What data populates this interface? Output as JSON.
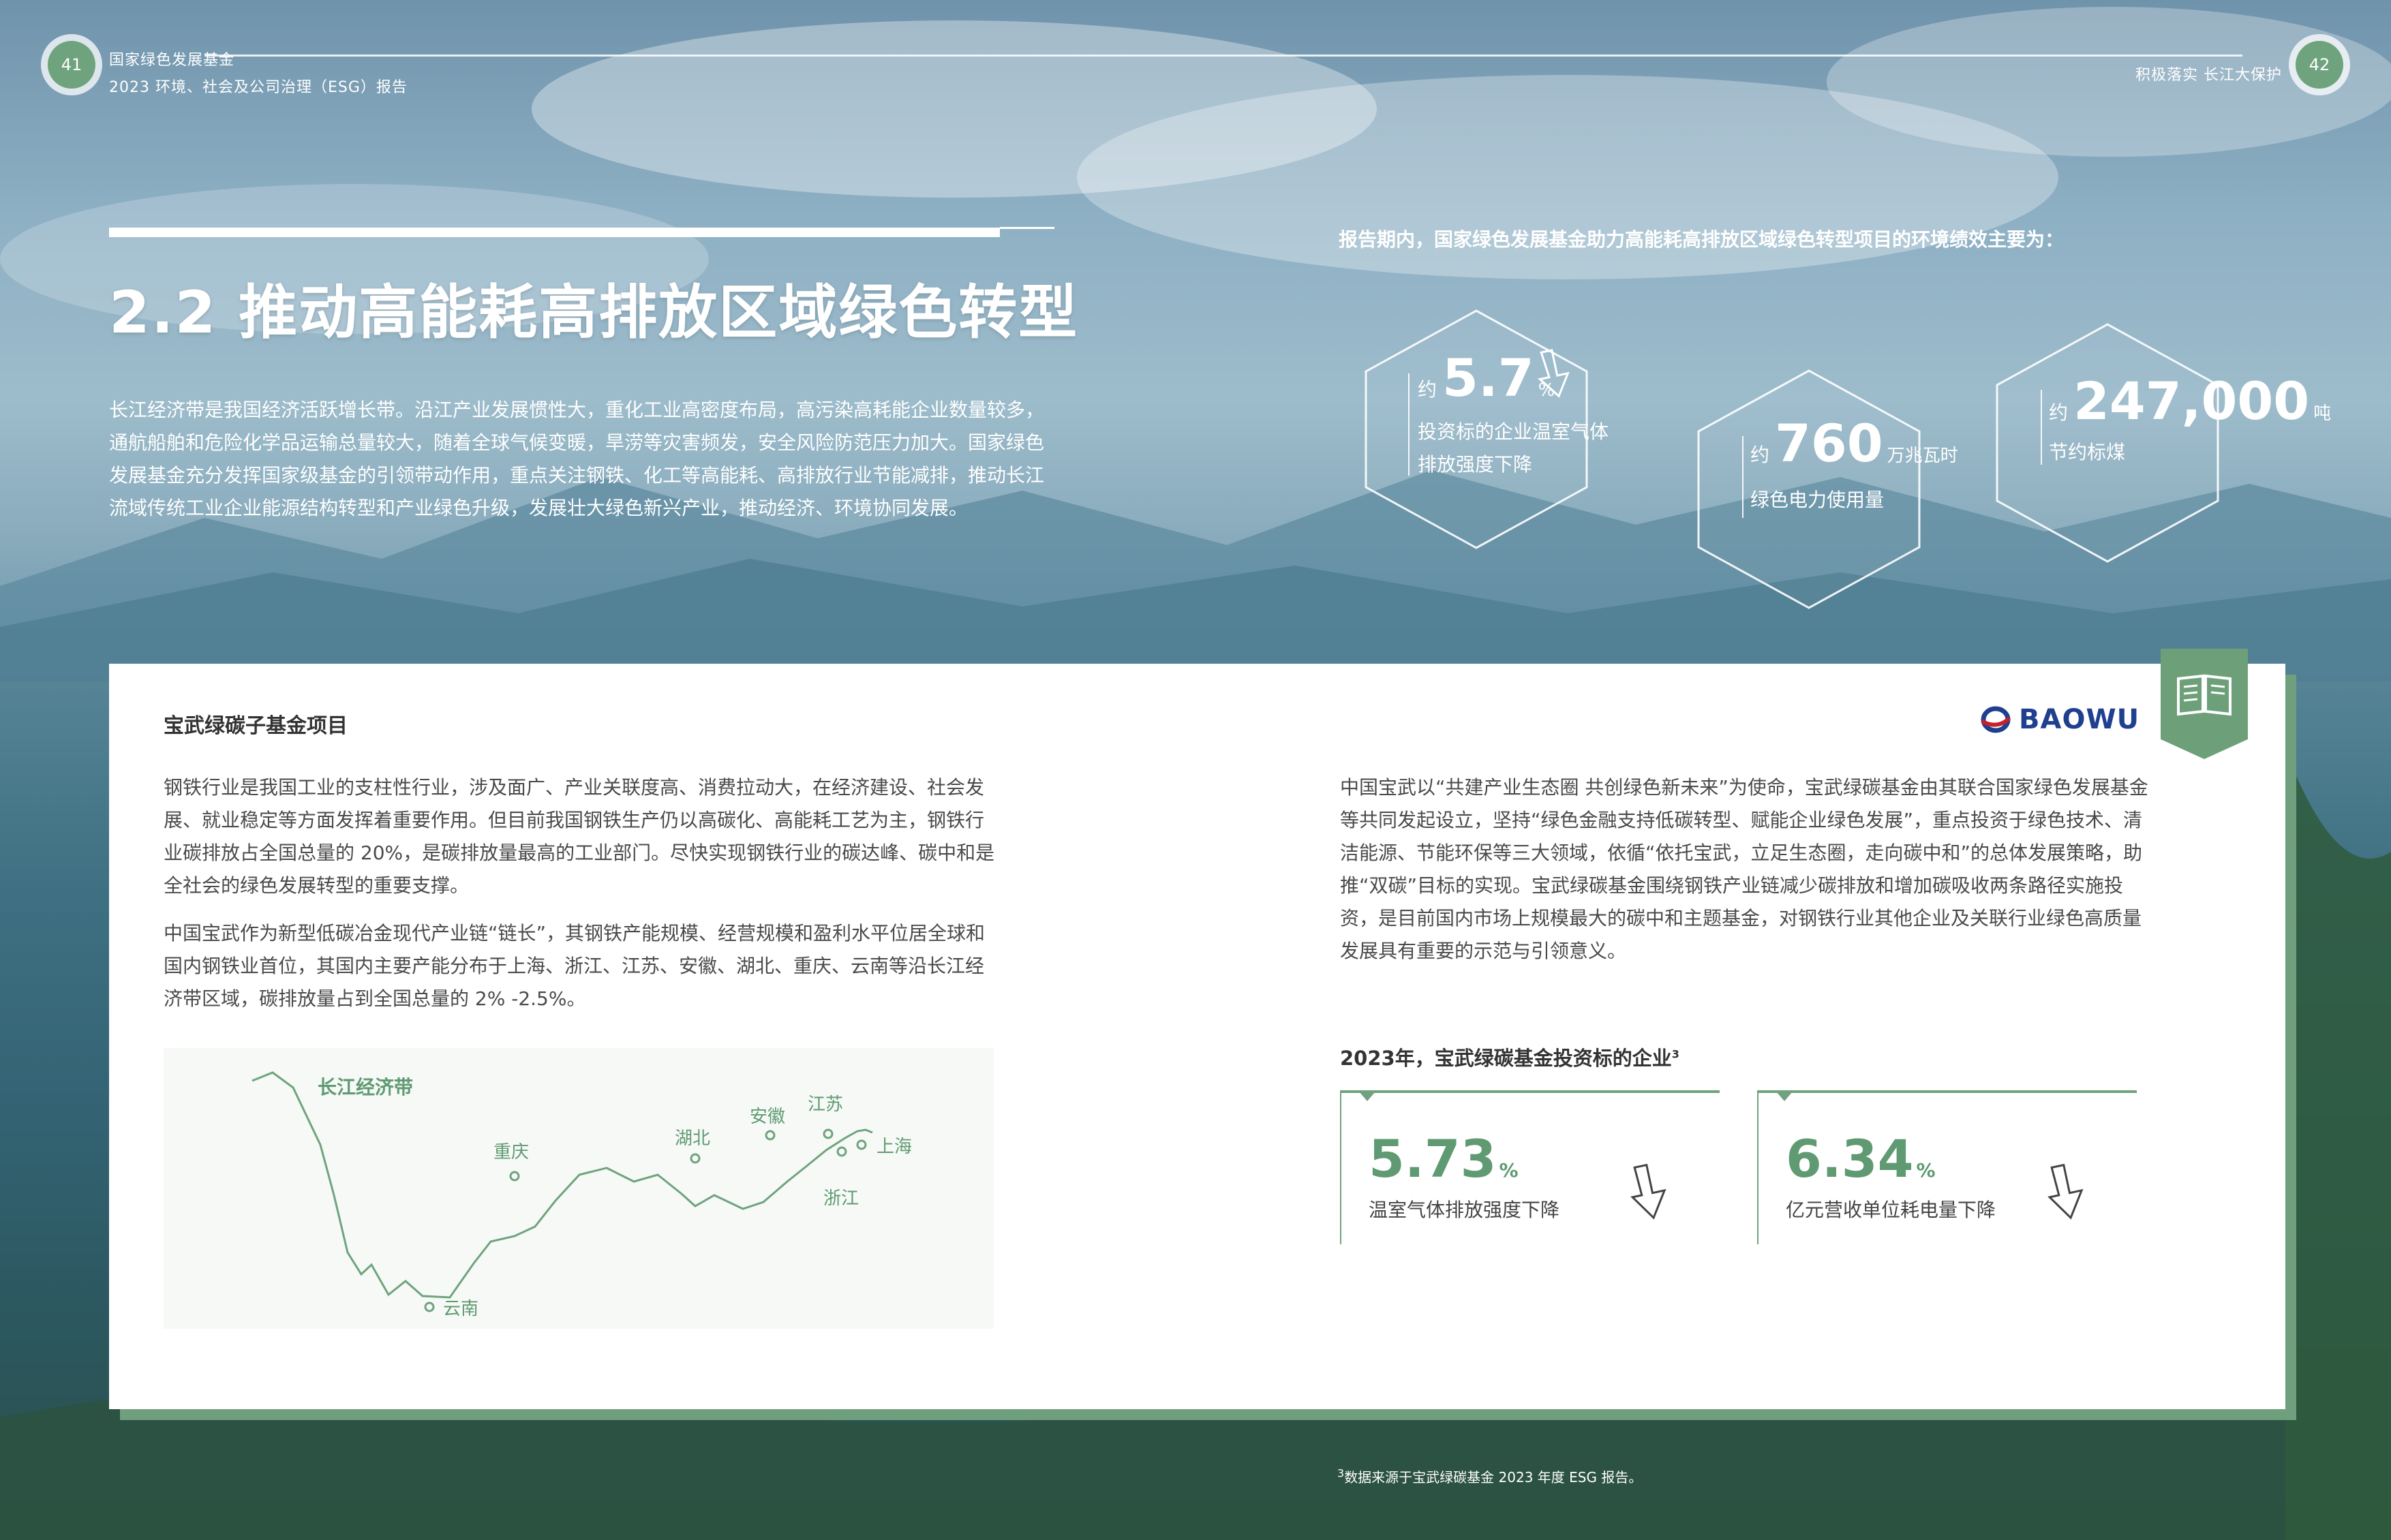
{
  "header": {
    "org": "国家绿色发展基金",
    "report": "2023 环境、社会及公司治理（ESG）报告",
    "right_section": "积极落实 长江大保护",
    "page_left": "41",
    "page_right": "42"
  },
  "section": {
    "title": "2.2 推动高能耗高排放区域绿色转型",
    "intro": "长江经济带是我国经济活跃增长带。沿江产业发展惯性大，重化工业高密度布局，高污染高耗能企业数量较多，通航船舶和危险化学品运输总量较大，随着全球气候变暖，旱涝等灾害频发，安全风险防范压力加大。国家绿色发展基金充分发挥国家级基金的引领带动作用，重点关注钢铁、化工等高能耗、高排放行业节能减排，推动长江流域传统工业企业能源结构转型和产业绿色升级，发展壮大绿色新兴产业，推动经济、环境协同发展。"
  },
  "performance": {
    "title": "报告期内，国家绿色发展基金助力高能耗高排放区域绿色转型项目的环境绩效主要为：",
    "stats": [
      {
        "prefix": "约",
        "value": "5.7",
        "unit": "%",
        "desc_line1": "投资标的企业温室气体",
        "desc_line2": "排放强度下降"
      },
      {
        "prefix": "约",
        "value": "760",
        "unit": "万兆瓦时",
        "desc_line1": "绿色电力使用量"
      },
      {
        "prefix": "约",
        "value": "247,000",
        "unit": "吨",
        "desc_line1": "节约标煤"
      }
    ]
  },
  "case": {
    "heading": "宝武绿碳子基金项目",
    "logo_text": "BAOWU",
    "para1": "钢铁行业是我国工业的支柱性行业，涉及面广、产业关联度高、消费拉动大，在经济建设、社会发展、就业稳定等方面发挥着重要作用。但目前我国钢铁生产仍以高碳化、高能耗工艺为主，钢铁行业碳排放占全国总量的 20%，是碳排放量最高的工业部门。尽快实现钢铁行业的碳达峰、碳中和是全社会的绿色发展转型的重要支撑。",
    "para2": "中国宝武作为新型低碳冶金现代产业链“链长”，其钢铁产能规模、经营规模和盈利水平位居全球和国内钢铁业首位，其国内主要产能分布于上海、浙江、江苏、安徽、湖北、重庆、云南等沿长江经济带区域，碳排放量占到全国总量的 2% -2.5%。",
    "para3": "中国宝武以“共建产业生态圈 共创绿色新未来”为使命，宝武绿碳基金由其联合国家绿色发展基金等共同发起设立，坚持“绿色金融支持低碳转型、赋能企业绿色发展”，重点投资于绿色技术、清洁能源、节能环保等三大领域，依循“依托宝武，立足生态圈，走向碳中和”的总体发展策略，助推“双碳”目标的实现。宝武绿碳基金围绕钢铁产业链减少碳排放和增加碳吸收两条路径实施投资，是目前国内市场上规模最大的碳中和主题基金，对钢铁行业其他企业及关联行业绿色高质量发展具有重要的示范与引领意义。",
    "map": {
      "title": "长江经济带",
      "places": [
        "重庆",
        "湖北",
        "安徽",
        "江苏",
        "上海",
        "浙江",
        "云南"
      ]
    },
    "kpi_title": "2023年，宝武绿碳基金投资标的企业",
    "kpi_footnote_mark": "3",
    "kpis": [
      {
        "value": "5.73",
        "unit": "%",
        "desc": "温室气体排放强度下降"
      },
      {
        "value": "6.34",
        "unit": "%",
        "desc": "亿元营收单位耗电量下降"
      }
    ]
  },
  "footnote": {
    "mark": "3",
    "text": "数据来源于宝武绿碳基金 2023 年度 ESG 报告。"
  },
  "colors": {
    "accent": "#6fa37e",
    "logo_blue": "#1f3f8f",
    "logo_red": "#c8202a"
  }
}
